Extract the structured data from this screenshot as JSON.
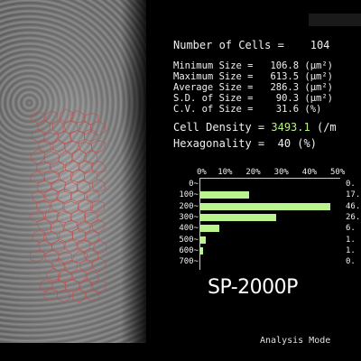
{
  "stats": {
    "number_of_cells": "Number of Cells =    104",
    "minimum_size": "Minimum Size =   106.8 (μm²)",
    "maximum_size": "Maximum Size =   613.5 (μm²)",
    "average_size": "Average Size =   286.3 (μm²)",
    "sd_size": "S.D. of Size =    90.3 (μm²)",
    "cv_size": "C.V. of Size =    31.6 (%)",
    "cell_density_label": "Cell Density = ",
    "cell_density_value": "3493.1",
    "cell_density_unit": "(/m",
    "hexagonality": "Hexagonality =  40 (%)"
  },
  "histogram": {
    "axis_ticks": [
      "0%",
      "10%",
      "20%",
      "30%",
      "40%",
      "50%"
    ],
    "rows": [
      {
        "label": "0~",
        "percent": 0,
        "pct_text": "0."
      },
      {
        "label": "100~",
        "percent": 17.3,
        "pct_text": "17."
      },
      {
        "label": "200~",
        "percent": 46.2,
        "pct_text": "46."
      },
      {
        "label": "300~",
        "percent": 26.9,
        "pct_text": "26."
      },
      {
        "label": "400~",
        "percent": 6.7,
        "pct_text": "6."
      },
      {
        "label": "500~",
        "percent": 1.9,
        "pct_text": "1."
      },
      {
        "label": "600~",
        "percent": 1.0,
        "pct_text": "1."
      },
      {
        "label": "700~",
        "percent": 0,
        "pct_text": "0."
      }
    ],
    "bar_color": "#b9f48e"
  },
  "model_name": "SP-2000P",
  "mode_label": "Analysis Mode",
  "colors": {
    "background": "#000000",
    "accent_value": "#b8f08a",
    "cell_outline": "#c0504d"
  }
}
